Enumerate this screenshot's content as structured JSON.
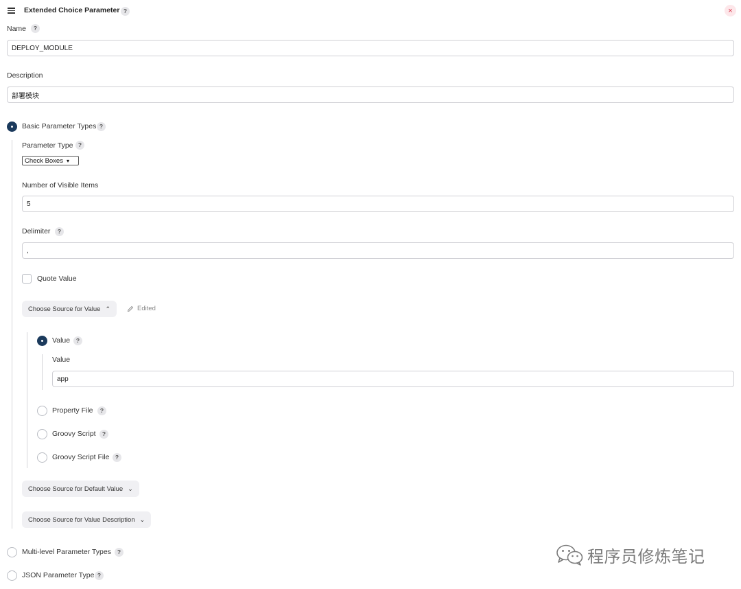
{
  "header": {
    "title": "Extended Choice Parameter",
    "help": "?",
    "close": "×"
  },
  "name": {
    "label": "Name",
    "help": "?",
    "value": "DEPLOY_MODULE"
  },
  "description": {
    "label": "Description",
    "value": "部署模块"
  },
  "basic": {
    "label": "Basic Parameter Types",
    "help": "?",
    "parameter_type": {
      "label": "Parameter Type",
      "help": "?",
      "selected": "Check Boxes",
      "arrow": "▾"
    },
    "visible_items": {
      "label": "Number of Visible Items",
      "value": "5"
    },
    "delimiter": {
      "label": "Delimiter",
      "help": "?",
      "value": ","
    },
    "quote_value": {
      "label": "Quote Value"
    },
    "source_value": {
      "button": "Choose Source for Value",
      "chevron": "⌃",
      "edited": "Edited",
      "options": [
        {
          "label": "Value",
          "help": "?",
          "selected": true
        },
        {
          "label": "Property File",
          "help": "?"
        },
        {
          "label": "Groovy Script",
          "help": "?"
        },
        {
          "label": "Groovy Script File",
          "help": "?"
        }
      ],
      "value_field": {
        "label": "Value",
        "value": "app"
      }
    },
    "default_value_button": "Choose Source for Default Value",
    "value_description_button": "Choose Source for Value Description",
    "chevron_down": "⌄"
  },
  "multi_level": {
    "label": "Multi-level Parameter Types",
    "help": "?"
  },
  "json_type": {
    "label": "JSON Parameter Type",
    "help": "?"
  },
  "watermark": "程序员修炼笔记"
}
